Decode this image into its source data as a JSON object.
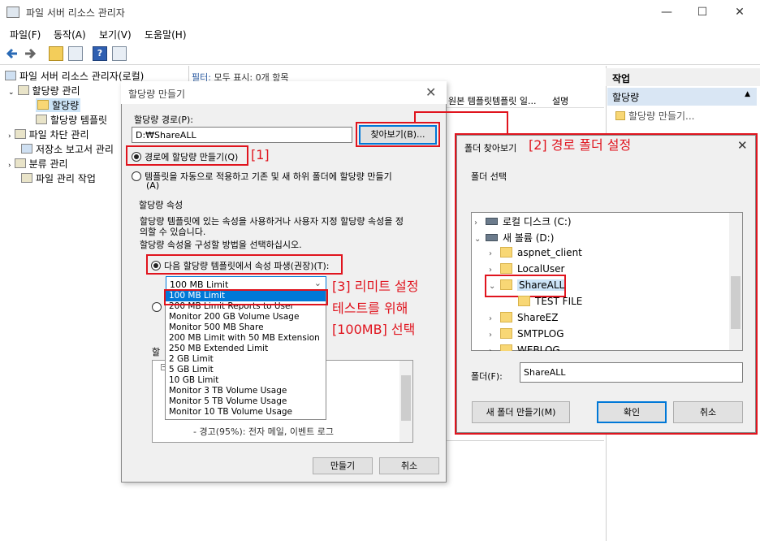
{
  "window": {
    "title": "파일 서버 리소스 관리자",
    "min": "—",
    "max": "☐",
    "close": "✕"
  },
  "menu": [
    "파일(F)",
    "동작(A)",
    "보기(V)",
    "도움말(H)"
  ],
  "tree": {
    "root": "파일 서버 리소스 관리자(로컬)",
    "quota_mgmt": "할당량 관리",
    "quota": "할당량",
    "quota_tpl": "할당량 템플릿",
    "file_screen": "파일 차단 관리",
    "storage_reports": "저장소 보고서 관리",
    "classification": "분류 관리",
    "file_tasks": "파일 관리 작업"
  },
  "center": {
    "filter_label": "필터:",
    "filter_text": "모두 표시: 0개 항목",
    "cols": [
      "원본 템플릿",
      "템플릿 일...",
      "설명"
    ]
  },
  "actions": {
    "header": "작업",
    "sub": "할당량",
    "item": "할당량 만들기..."
  },
  "quota_dialog": {
    "title": "할당량 만들기",
    "close": "✕",
    "path_label": "할당량 경로(P):",
    "path_value": "D:₩ShareALL",
    "browse": "찾아보기(B)...",
    "opt_create_on_path": "경로에 할당량 만들기(Q)",
    "opt_auto_apply": "템플릿을 자동으로 적용하고 기존 및 새 하위 폴더에 할당량 만들기",
    "opt_auto_apply_key": "(A)",
    "props_group": "할당량 속성",
    "props_desc1": "할당량 템플릿에 있는 속성을 사용하거나 사용자 지정 할당량 속성을 정",
    "props_desc2": "의할 수 있습니다.",
    "props_desc3": "할당량 속성을 구성할 방법을 선택하십시오.",
    "opt_derive": "다음 할당량 템플릿에서 속성 파생(권장)(T):",
    "selected_template": "100 MB Limit",
    "template_options": [
      "100 MB Limit",
      "200 MB Limit Reports to User",
      "Monitor 200 GB Volume Usage",
      "Monitor 500 MB Share",
      "200 MB Limit with 50 MB Extension",
      "250 MB Extended Limit",
      "2 GB Limit",
      "5 GB Limit",
      "10 GB Limit",
      "Monitor 3 TB Volume Usage",
      "Monitor 5 TB Volume Usage",
      "Monitor 10 TB Volume Usage"
    ],
    "summary_label": "할",
    "summary_line1": "- 경고(95%): 전자 메일, 이벤트 로그",
    "create": "만들기",
    "cancel": "취소"
  },
  "folder_dialog": {
    "title": "폴더 찾아보기",
    "close": "✕",
    "select_label": "폴더 선택",
    "nodes": {
      "c_drive": "로컬 디스크 (C:)",
      "d_drive": "새 볼륨 (D:)",
      "aspnet": "aspnet_client",
      "localuser": "LocalUser",
      "shareall": "ShareALL",
      "testfile": "TEST FILE",
      "shareez": "ShareEZ",
      "smtplog": "SMTPLOG",
      "weblog": "WEBLOG"
    },
    "folder_label": "폴더(F):",
    "folder_value": "ShareALL",
    "new_folder": "새 폴더 만들기(M)",
    "ok": "확인",
    "cancel": "취소"
  },
  "annotations": {
    "a1": "[1]",
    "a2": "[2] 경로 폴더 설정",
    "a3_1": "[3] 리미트 설정",
    "a3_2": "테스트를 위해",
    "a3_3": "[100MB] 선택"
  },
  "colors": {
    "accent": "#0078d7",
    "annotation": "#e0141e"
  }
}
